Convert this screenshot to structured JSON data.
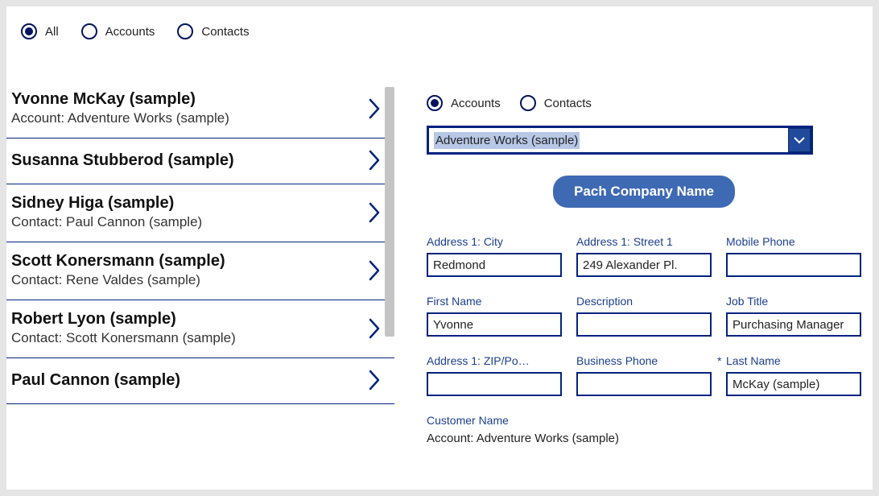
{
  "topFilters": {
    "options": [
      {
        "label": "All",
        "selected": true
      },
      {
        "label": "Accounts",
        "selected": false
      },
      {
        "label": "Contacts",
        "selected": false
      }
    ]
  },
  "list": [
    {
      "title": "Yvonne McKay (sample)",
      "sub": "Account: Adventure Works (sample)"
    },
    {
      "title": "Susanna Stubberod (sample)",
      "sub": ""
    },
    {
      "title": "Sidney Higa (sample)",
      "sub": "Contact: Paul Cannon (sample)"
    },
    {
      "title": "Scott Konersmann (sample)",
      "sub": "Contact: Rene Valdes (sample)"
    },
    {
      "title": "Robert Lyon (sample)",
      "sub": "Contact: Scott Konersmann (sample)"
    },
    {
      "title": "Paul Cannon (sample)",
      "sub": ""
    }
  ],
  "rightFilters": {
    "options": [
      {
        "label": "Accounts",
        "selected": true
      },
      {
        "label": "Contacts",
        "selected": false
      }
    ]
  },
  "combo": {
    "selected": "Adventure Works (sample)"
  },
  "primaryButton": "Pach Company Name",
  "fields": [
    {
      "label": "Address 1: City",
      "value": "Redmond",
      "required": false
    },
    {
      "label": "Address 1: Street 1",
      "value": "249 Alexander Pl.",
      "required": false
    },
    {
      "label": "Mobile Phone",
      "value": "",
      "required": false
    },
    {
      "label": "First Name",
      "value": "Yvonne",
      "required": false
    },
    {
      "label": "Description",
      "value": "",
      "required": false
    },
    {
      "label": "Job Title",
      "value": "Purchasing Manager",
      "required": false
    },
    {
      "label": "Address 1: ZIP/Po…",
      "value": "",
      "required": false
    },
    {
      "label": "Business Phone",
      "value": "",
      "required": false
    },
    {
      "label": "Last Name",
      "value": "McKay (sample)",
      "required": true
    }
  ],
  "customerName": {
    "label": "Customer Name",
    "value": "Account: Adventure Works (sample)"
  }
}
